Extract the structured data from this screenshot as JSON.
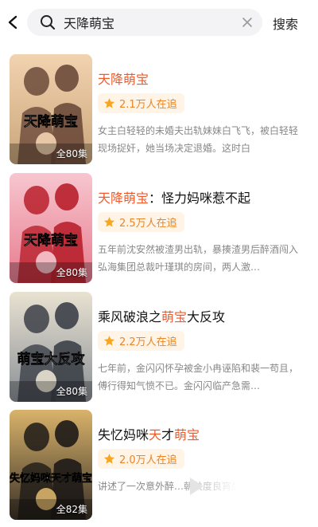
{
  "search": {
    "query": "天降萌宝",
    "button_label": "搜索"
  },
  "results": [
    {
      "title_parts": [
        {
          "text": "天降萌宝",
          "hl": true
        }
      ],
      "watchers": "2.1万人在追",
      "description": "女主白轻轻的未婚夫出轨妹妹白飞飞，被白轻轻现场捉奸，她当场决定退婚。这时白",
      "episodes": "全80集",
      "poster_title": "天降萌宝",
      "poster_colors": [
        "#c9a57a",
        "#6b4a3a",
        "#f2d3b0"
      ]
    },
    {
      "title_parts": [
        {
          "text": "天降萌宝",
          "hl": true
        },
        {
          "text": "：怪力妈咪惹不起",
          "hl": false
        }
      ],
      "watchers": "2.5万人在追",
      "description": "五年前沈安然被渣男出轨，暴揍渣男后醉酒闯入弘海集团总裁叶瑾琪的房间，两人激…",
      "episodes": "全80集",
      "poster_title": "天降萌宝",
      "poster_colors": [
        "#e77b8e",
        "#b8202c",
        "#f7c6cf"
      ]
    },
    {
      "title_parts": [
        {
          "text": "乘风破浪之",
          "hl": false
        },
        {
          "text": "萌宝",
          "hl": true
        },
        {
          "text": "大反攻",
          "hl": false
        }
      ],
      "watchers": "2.2万人在追",
      "description": "七年前，金闪闪怀孕被金小冉诬陷和裴一苟且，傅行得知气愤不已。金闪闪临产急需…",
      "episodes": "全80集",
      "poster_title": "萌宝大反攻",
      "poster_colors": [
        "#8a8f96",
        "#3c4048",
        "#e9e2d2"
      ]
    },
    {
      "title_parts": [
        {
          "text": "失忆妈咪",
          "hl": false
        },
        {
          "text": "天",
          "hl": true
        },
        {
          "text": "才",
          "hl": false
        },
        {
          "text": "萌宝",
          "hl": true
        }
      ],
      "watchers": "2.0万人在追",
      "description": "讲述了一次意外醉…朝共度良宵后，儿…",
      "episodes": "全82集",
      "poster_title": "失忆妈咪天才萌宝",
      "poster_colors": [
        "#3a3128",
        "#1e1a17",
        "#d9b36a"
      ]
    }
  ]
}
